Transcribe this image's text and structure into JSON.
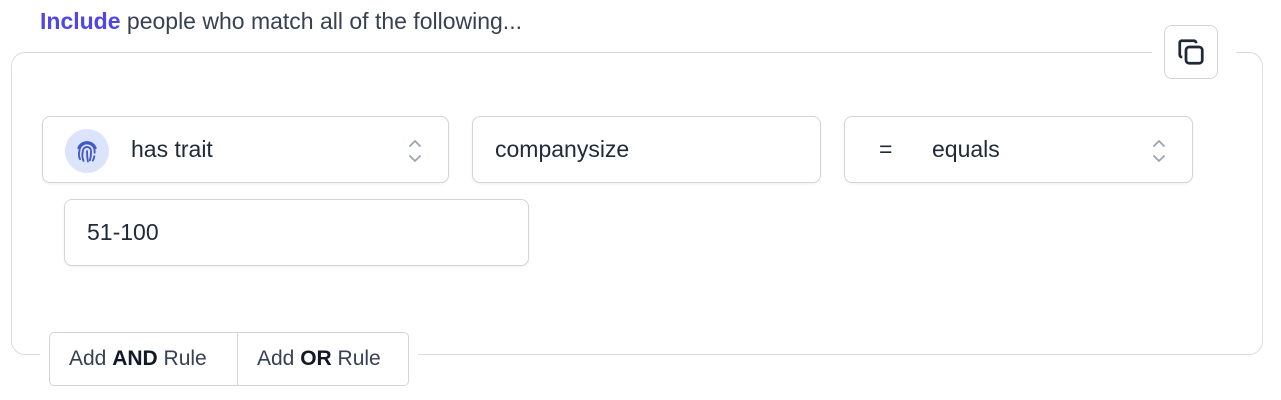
{
  "heading": {
    "keyword": "Include",
    "rest": " people who match all of the following..."
  },
  "rule": {
    "condition_select": {
      "value": "has trait",
      "icon": "fingerprint-icon"
    },
    "trait_input": {
      "value": "companysize"
    },
    "operator_select": {
      "symbol": "=",
      "value": "equals"
    },
    "value_input": {
      "value": "51-100"
    }
  },
  "actions": {
    "add_and": {
      "prefix": "Add ",
      "emphasis": "AND",
      "suffix": " Rule"
    },
    "add_or": {
      "prefix": "Add ",
      "emphasis": "OR",
      "suffix": " Rule"
    }
  },
  "colors": {
    "accent": "#4f46e5",
    "border": "#d1d5db",
    "icon_bg": "#dbe4fb",
    "icon_fg": "#4357c9"
  }
}
